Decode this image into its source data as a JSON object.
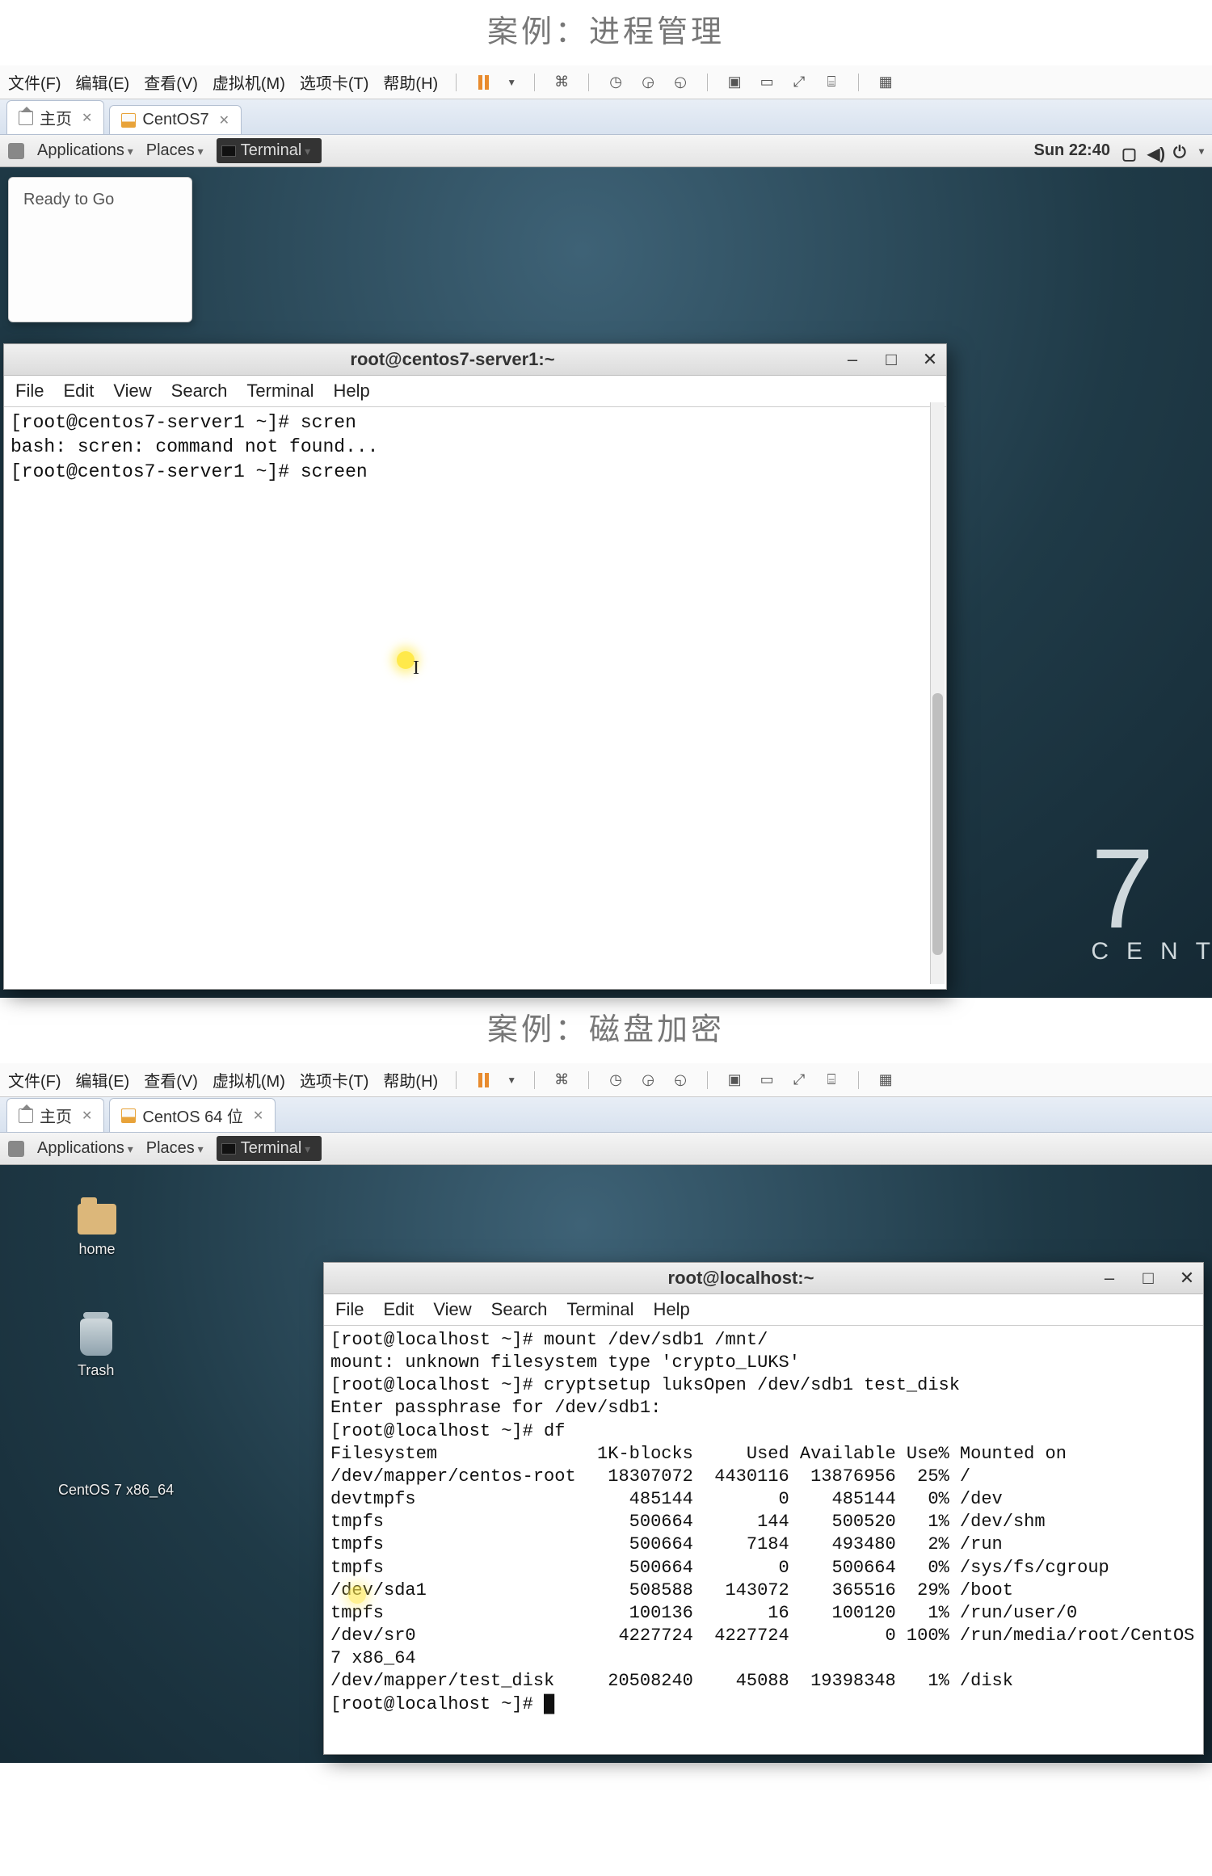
{
  "section1": {
    "caption": "案例：进程管理",
    "host_menu": [
      "文件(F)",
      "编辑(E)",
      "查看(V)",
      "虚拟机(M)",
      "选项卡(T)",
      "帮助(H)"
    ],
    "tabs": [
      {
        "label": "主页",
        "closable": true,
        "icon": "home"
      },
      {
        "label": "CentOS7",
        "closable": true,
        "icon": "vm"
      }
    ],
    "gnome": {
      "apps": "Applications",
      "places": "Places",
      "terminal_task": "Terminal",
      "clock": "Sun 22:40"
    },
    "notification": {
      "title": "Ready to Go"
    },
    "centos": {
      "num": "7",
      "label": "CENT"
    },
    "term": {
      "title": "root@centos7-server1:~",
      "menu": [
        "File",
        "Edit",
        "View",
        "Search",
        "Terminal",
        "Help"
      ],
      "lines": [
        "[root@centos7-server1 ~]# scren",
        "bash: scren: command not found...",
        "[root@centos7-server1 ~]# screen"
      ]
    }
  },
  "section2": {
    "caption": "案例：磁盘加密",
    "host_menu": [
      "文件(F)",
      "编辑(E)",
      "查看(V)",
      "虚拟机(M)",
      "选项卡(T)",
      "帮助(H)"
    ],
    "tabs": [
      {
        "label": "主页",
        "closable": true,
        "icon": "home"
      },
      {
        "label": "CentOS 64 位",
        "closable": true,
        "icon": "vm"
      }
    ],
    "gnome": {
      "apps": "Applications",
      "places": "Places",
      "terminal_task": "Terminal"
    },
    "desktop_icons": [
      {
        "kind": "folder",
        "label": "home"
      },
      {
        "kind": "trash",
        "label": "Trash"
      },
      {
        "kind": "disc",
        "label": "CentOS 7 x86_64"
      }
    ],
    "term": {
      "title": "root@localhost:~",
      "menu": [
        "File",
        "Edit",
        "View",
        "Search",
        "Terminal",
        "Help"
      ],
      "lines": [
        "[root@localhost ~]# mount /dev/sdb1 /mnt/",
        "mount: unknown filesystem type 'crypto_LUKS'",
        "[root@localhost ~]# cryptsetup luksOpen /dev/sdb1 test_disk",
        "Enter passphrase for /dev/sdb1:",
        "[root@localhost ~]# df"
      ],
      "df": {
        "header": [
          "Filesystem",
          "1K-blocks",
          "Used",
          "Available",
          "Use%",
          "Mounted on"
        ],
        "rows": [
          [
            "/dev/mapper/centos-root",
            "18307072",
            "4430116",
            "13876956",
            "25%",
            "/"
          ],
          [
            "devtmpfs",
            "485144",
            "0",
            "485144",
            "0%",
            "/dev"
          ],
          [
            "tmpfs",
            "500664",
            "144",
            "500520",
            "1%",
            "/dev/shm"
          ],
          [
            "tmpfs",
            "500664",
            "7184",
            "493480",
            "2%",
            "/run"
          ],
          [
            "tmpfs",
            "500664",
            "0",
            "500664",
            "0%",
            "/sys/fs/cgroup"
          ],
          [
            "/dev/sda1",
            "508588",
            "143072",
            "365516",
            "29%",
            "/boot"
          ],
          [
            "tmpfs",
            "100136",
            "16",
            "100120",
            "1%",
            "/run/user/0"
          ],
          [
            "/dev/sr0",
            "4227724",
            "4227724",
            "0",
            "100%",
            "/run/media/root/CentOS"
          ],
          [
            "7 x86_64",
            "",
            "",
            "",
            "",
            ""
          ],
          [
            "/dev/mapper/test_disk",
            "20508240",
            "45088",
            "19398348",
            "1%",
            "/disk"
          ]
        ]
      },
      "tail": "[root@localhost ~]# █"
    }
  }
}
